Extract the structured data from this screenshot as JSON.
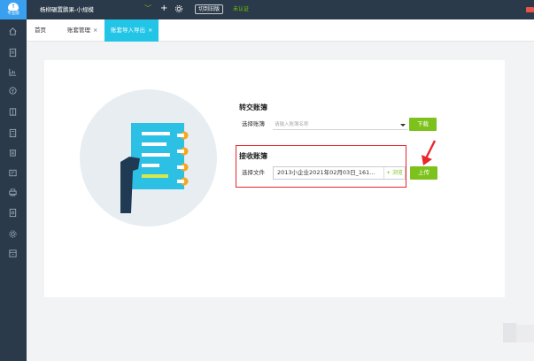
{
  "app": {
    "logo_label": "专业版",
    "company_name": "杨柳碾置鹏果-小规模",
    "switch_button": "切到旧版",
    "status_text": "未认证"
  },
  "tabs": [
    {
      "label": "首页"
    },
    {
      "label": "账套管理",
      "close": "×"
    },
    {
      "label": "账套导入导出",
      "close": "×"
    }
  ],
  "sidebar": {
    "icons": [
      "home-icon",
      "document-icon",
      "chart-icon",
      "money-icon",
      "ledger-icon",
      "calculator-icon",
      "invoice-icon",
      "report-icon",
      "print-icon",
      "search-doc-icon",
      "settings-icon",
      "archive-icon"
    ]
  },
  "transfer": {
    "title": "转交账簿",
    "select_label": "选择账簿",
    "select_placeholder": "请输入账簿名称",
    "download_button": "下载"
  },
  "receive": {
    "title": "接收账簿",
    "file_label": "选择文件",
    "file_value": "2013小企业2021年02月03日_161...",
    "browse_button": "+ 浏览",
    "upload_button": "上传"
  },
  "colors": {
    "sidebar_bg": "#2b3a4a",
    "accent_tab": "#22c5e6",
    "action_green": "#7dc21c",
    "highlight_red": "#e8262b"
  }
}
